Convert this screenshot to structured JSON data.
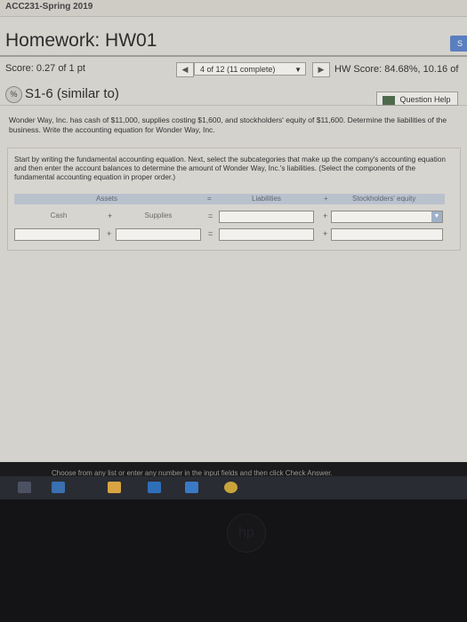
{
  "course": {
    "title": "ACC231-Spring 2019"
  },
  "homework": {
    "title": "Homework: HW01",
    "save_label": "S"
  },
  "score": {
    "text": "Score: 0.27 of 1 pt",
    "progress": "4 of 12 (11 complete)",
    "hw_score": "HW Score: 84.68%, 10.16 of"
  },
  "question": {
    "title": "S1-6 (similar to)",
    "help_label": "Question Help"
  },
  "problem": {
    "text": "Wonder Way, Inc. has cash of $11,000, supplies costing $1,600, and stockholders' equity of $11,600. Determine the liabilities of the business. Write the accounting equation for Wonder Way, Inc."
  },
  "instructions": {
    "text": "Start by writing the fundamental accounting equation. Next, select the subcategories that make up the company's accounting equation and then enter the account balances to determine the amount of Wonder Way, Inc.'s liabilities. (Select the components of the fundamental accounting equation in proper order.)"
  },
  "equation": {
    "headers": {
      "assets": "Assets",
      "liabilities": "Liabilities",
      "equity": "Stockholders' equity"
    },
    "operators": {
      "equals": "=",
      "plus": "+"
    },
    "row1": {
      "cash": "Cash",
      "supplies": "Supplies"
    }
  },
  "bottom": {
    "instruction": "Choose from any list or enter any number in the input fields and then click Check Answer."
  },
  "taskbar": {
    "icons": [
      "task-view-icon",
      "edge-icon",
      "file-explorer-icon",
      "store-icon",
      "mail-icon",
      "chrome-icon"
    ]
  }
}
